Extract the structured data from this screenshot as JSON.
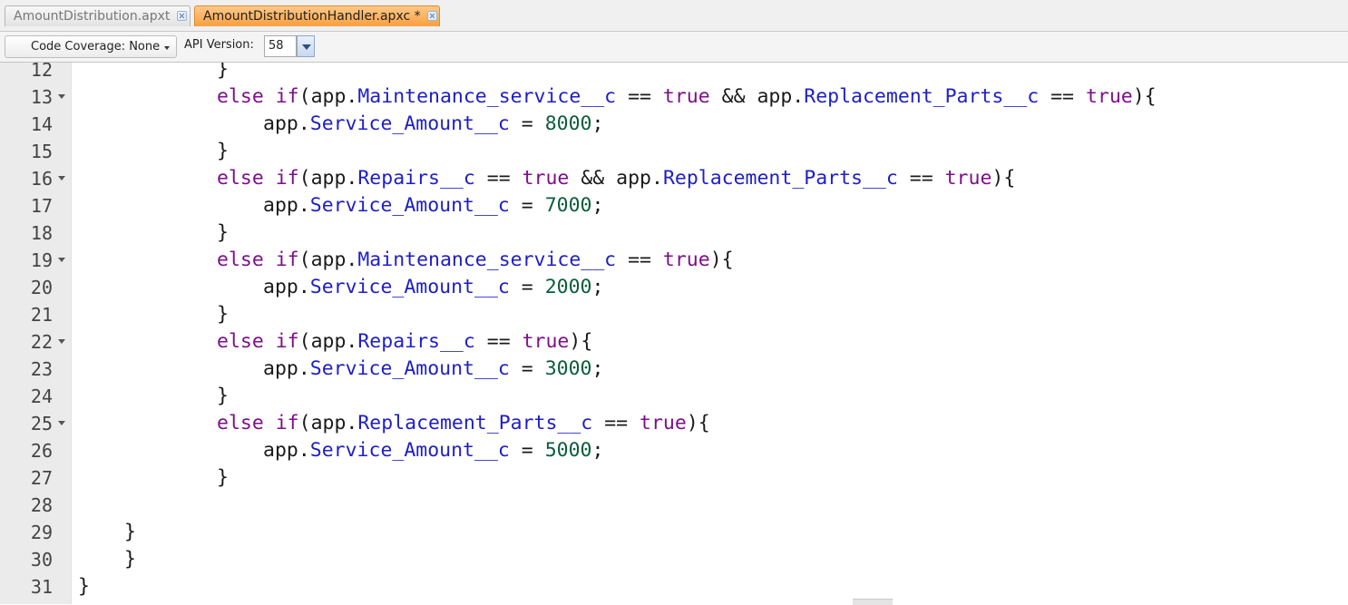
{
  "tabs": [
    {
      "label": "AmountDistribution.apxt",
      "active": false
    },
    {
      "label": "AmountDistributionHandler.apxc *",
      "active": true
    }
  ],
  "toolbar": {
    "coverage_label": "Code Coverage: None",
    "api_label": "API Version:",
    "api_value": "58"
  },
  "colors": {
    "keyword": "#7f0e8c",
    "field": "#1e1ec8",
    "number": "#0b5c3b",
    "active_tab": "#f7a03f"
  },
  "editor": {
    "lines": [
      {
        "n": "12",
        "fold": false,
        "indent": 3,
        "tokens": [
          [
            "p",
            "}"
          ]
        ]
      },
      {
        "n": "13",
        "fold": true,
        "indent": 3,
        "tokens": [
          [
            "k",
            "else"
          ],
          [
            "p",
            " "
          ],
          [
            "k",
            "if"
          ],
          [
            "p",
            "(app."
          ],
          [
            "f",
            "Maintenance_service__c"
          ],
          [
            "p",
            " == "
          ],
          [
            "k",
            "true"
          ],
          [
            "p",
            " && app."
          ],
          [
            "f",
            "Replacement_Parts__c"
          ],
          [
            "p",
            " == "
          ],
          [
            "k",
            "true"
          ],
          [
            "p",
            "){"
          ]
        ]
      },
      {
        "n": "14",
        "fold": false,
        "indent": 4,
        "tokens": [
          [
            "p",
            "app."
          ],
          [
            "f",
            "Service_Amount__c"
          ],
          [
            "p",
            " = "
          ],
          [
            "n",
            "8000"
          ],
          [
            "p",
            ";"
          ]
        ]
      },
      {
        "n": "15",
        "fold": false,
        "indent": 3,
        "tokens": [
          [
            "p",
            "}"
          ]
        ]
      },
      {
        "n": "16",
        "fold": true,
        "indent": 3,
        "tokens": [
          [
            "k",
            "else"
          ],
          [
            "p",
            " "
          ],
          [
            "k",
            "if"
          ],
          [
            "p",
            "(app."
          ],
          [
            "f",
            "Repairs__c"
          ],
          [
            "p",
            " == "
          ],
          [
            "k",
            "true"
          ],
          [
            "p",
            " && app."
          ],
          [
            "f",
            "Replacement_Parts__c"
          ],
          [
            "p",
            " == "
          ],
          [
            "k",
            "true"
          ],
          [
            "p",
            "){"
          ]
        ]
      },
      {
        "n": "17",
        "fold": false,
        "indent": 4,
        "tokens": [
          [
            "p",
            "app."
          ],
          [
            "f",
            "Service_Amount__c"
          ],
          [
            "p",
            " = "
          ],
          [
            "n",
            "7000"
          ],
          [
            "p",
            ";"
          ]
        ]
      },
      {
        "n": "18",
        "fold": false,
        "indent": 3,
        "tokens": [
          [
            "p",
            "}"
          ]
        ]
      },
      {
        "n": "19",
        "fold": true,
        "indent": 3,
        "tokens": [
          [
            "k",
            "else"
          ],
          [
            "p",
            " "
          ],
          [
            "k",
            "if"
          ],
          [
            "p",
            "(app."
          ],
          [
            "f",
            "Maintenance_service__c"
          ],
          [
            "p",
            " == "
          ],
          [
            "k",
            "true"
          ],
          [
            "p",
            "){"
          ]
        ]
      },
      {
        "n": "20",
        "fold": false,
        "indent": 4,
        "tokens": [
          [
            "p",
            "app."
          ],
          [
            "f",
            "Service_Amount__c"
          ],
          [
            "p",
            " = "
          ],
          [
            "n",
            "2000"
          ],
          [
            "p",
            ";"
          ]
        ]
      },
      {
        "n": "21",
        "fold": false,
        "indent": 3,
        "tokens": [
          [
            "p",
            "}"
          ]
        ]
      },
      {
        "n": "22",
        "fold": true,
        "indent": 3,
        "tokens": [
          [
            "k",
            "else"
          ],
          [
            "p",
            " "
          ],
          [
            "k",
            "if"
          ],
          [
            "p",
            "(app."
          ],
          [
            "f",
            "Repairs__c"
          ],
          [
            "p",
            " == "
          ],
          [
            "k",
            "true"
          ],
          [
            "p",
            "){"
          ]
        ]
      },
      {
        "n": "23",
        "fold": false,
        "indent": 4,
        "tokens": [
          [
            "p",
            "app."
          ],
          [
            "f",
            "Service_Amount__c"
          ],
          [
            "p",
            " = "
          ],
          [
            "n",
            "3000"
          ],
          [
            "p",
            ";"
          ]
        ]
      },
      {
        "n": "24",
        "fold": false,
        "indent": 3,
        "tokens": [
          [
            "p",
            "}"
          ]
        ]
      },
      {
        "n": "25",
        "fold": true,
        "indent": 3,
        "tokens": [
          [
            "k",
            "else"
          ],
          [
            "p",
            " "
          ],
          [
            "k",
            "if"
          ],
          [
            "p",
            "(app."
          ],
          [
            "f",
            "Replacement_Parts__c"
          ],
          [
            "p",
            " == "
          ],
          [
            "k",
            "true"
          ],
          [
            "p",
            "){"
          ]
        ]
      },
      {
        "n": "26",
        "fold": false,
        "indent": 4,
        "tokens": [
          [
            "p",
            "app."
          ],
          [
            "f",
            "Service_Amount__c"
          ],
          [
            "p",
            " = "
          ],
          [
            "n",
            "5000"
          ],
          [
            "p",
            ";"
          ]
        ]
      },
      {
        "n": "27",
        "fold": false,
        "indent": 3,
        "tokens": [
          [
            "p",
            "}"
          ]
        ]
      },
      {
        "n": "28",
        "fold": false,
        "indent": 0,
        "tokens": []
      },
      {
        "n": "29",
        "fold": false,
        "indent": 1,
        "tokens": [
          [
            "p",
            "}"
          ]
        ]
      },
      {
        "n": "30",
        "fold": false,
        "indent": 1,
        "tokens": [
          [
            "p",
            "}"
          ]
        ]
      },
      {
        "n": "31",
        "fold": false,
        "indent": 0,
        "tokens": [
          [
            "p",
            "}"
          ]
        ]
      }
    ]
  }
}
